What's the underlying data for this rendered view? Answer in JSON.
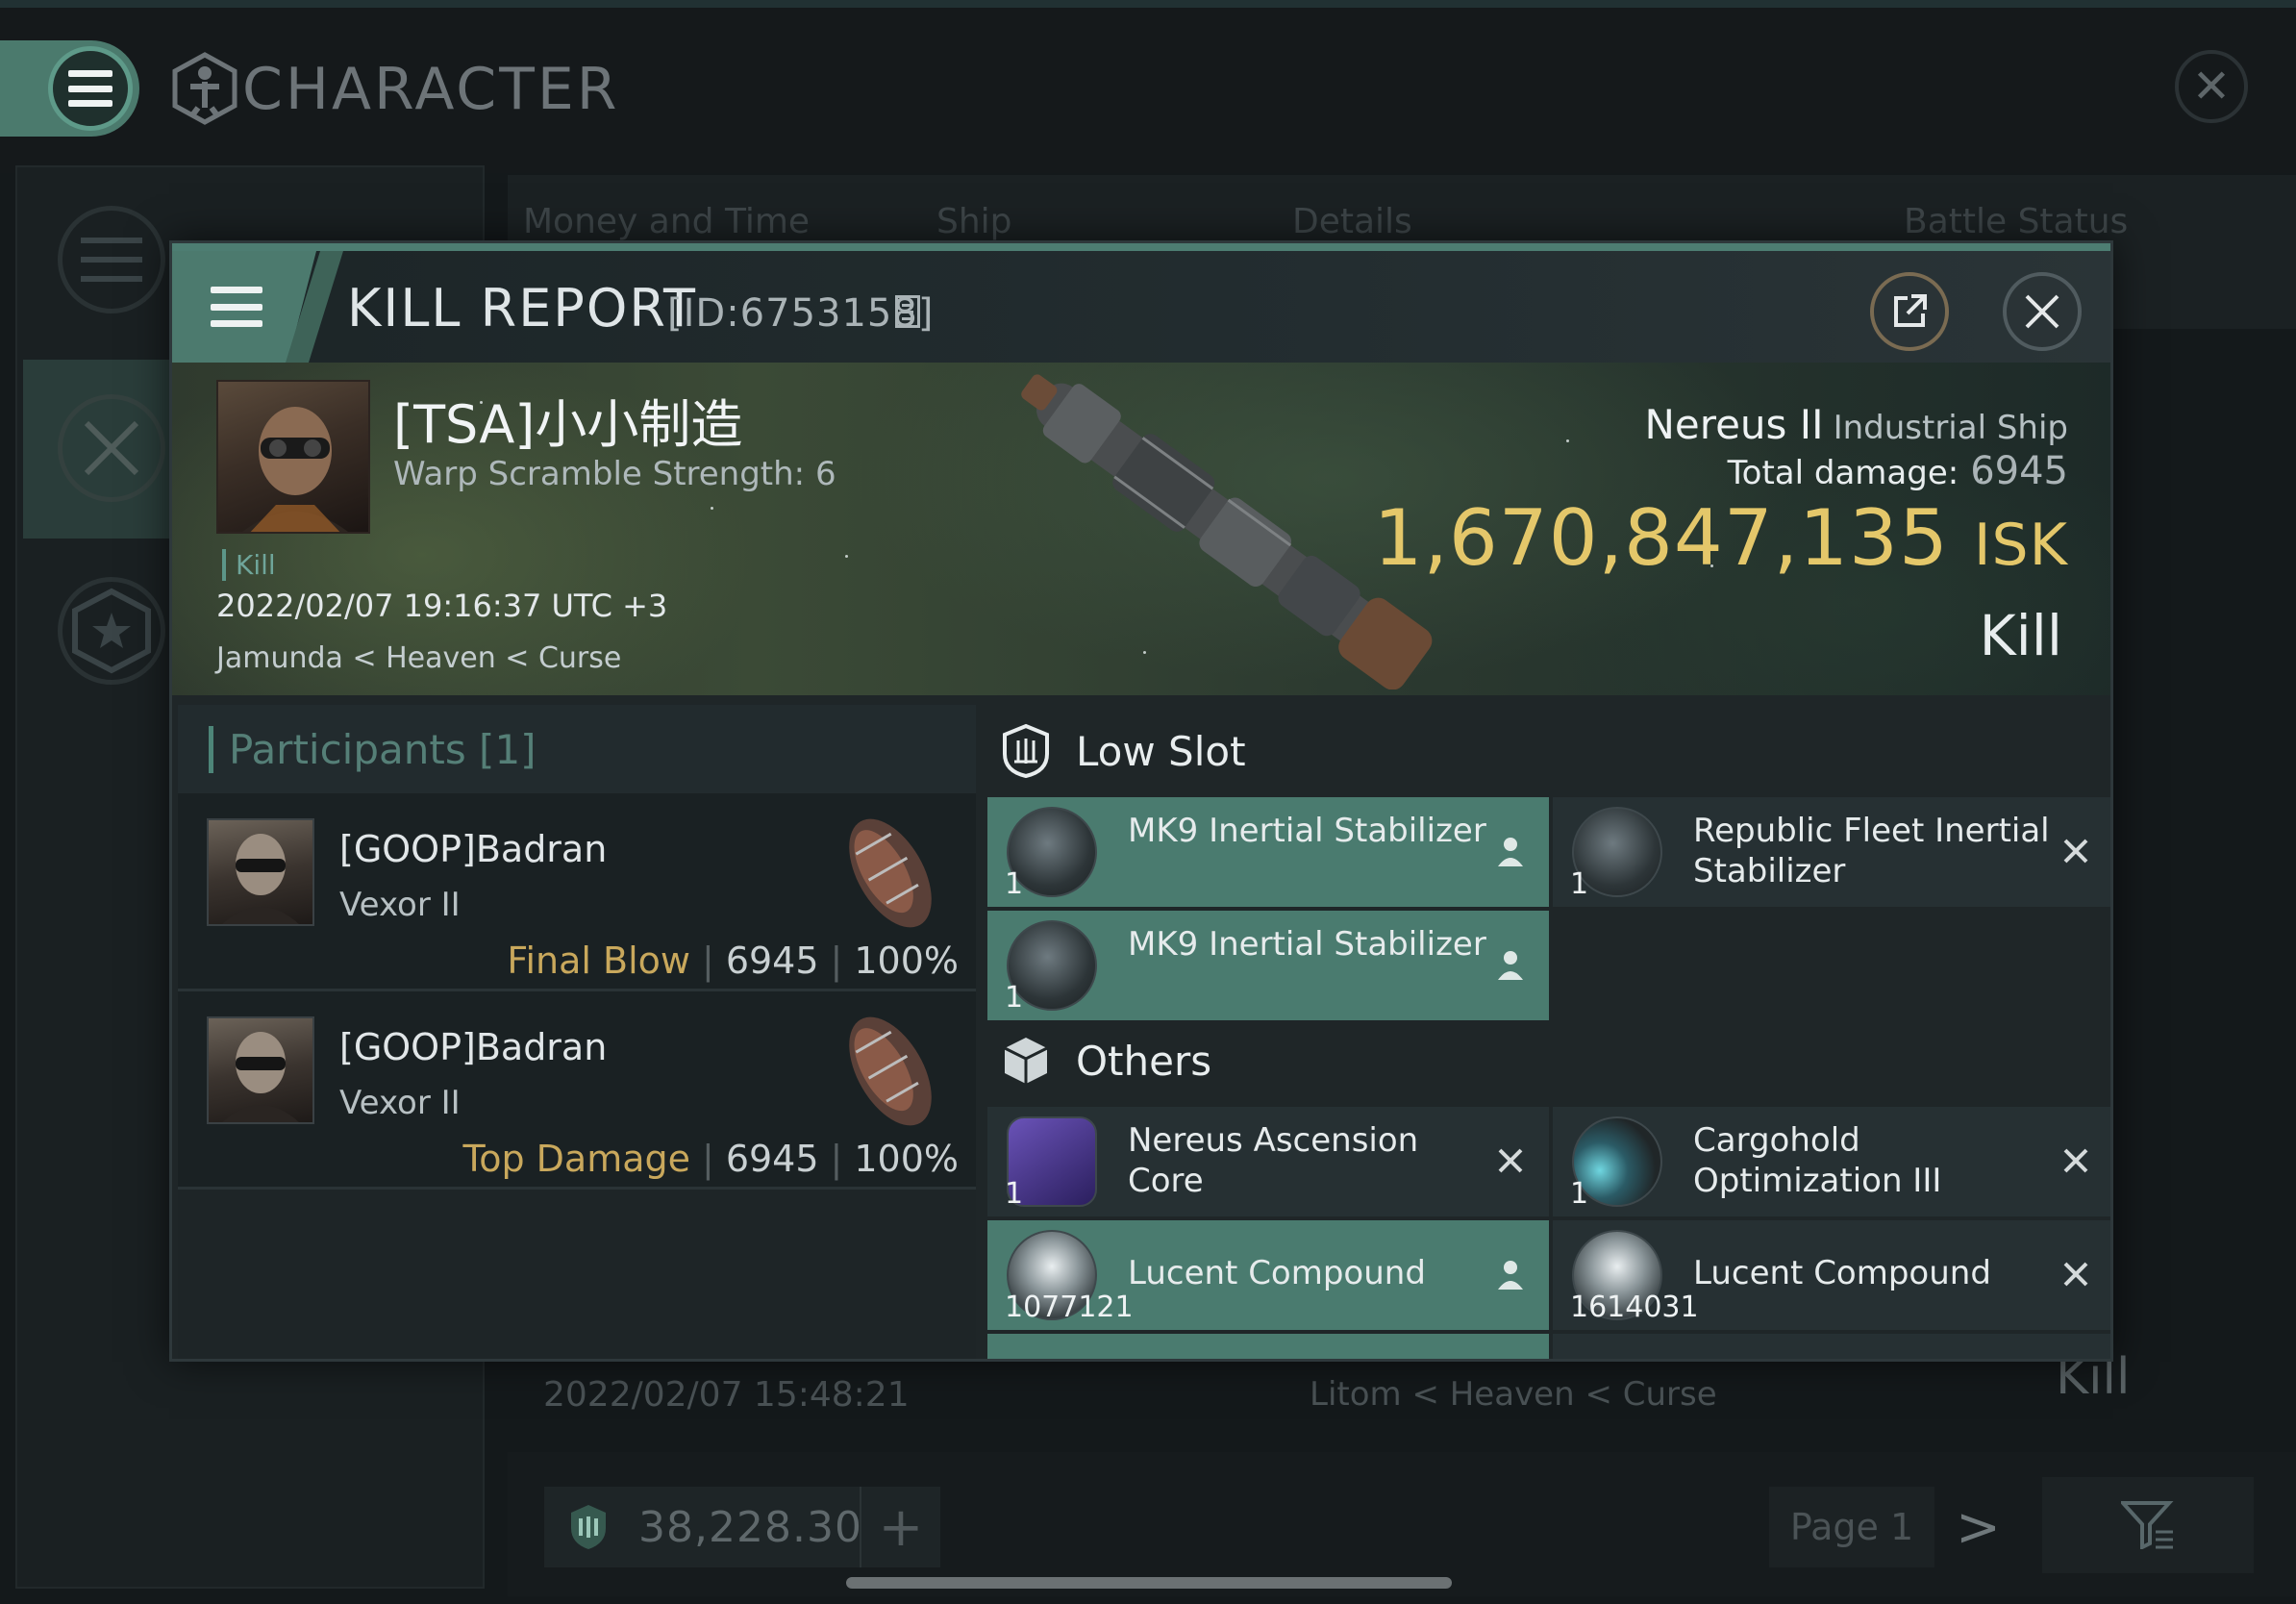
{
  "app": {
    "title": "CHARACTER"
  },
  "background": {
    "tabs": [
      "Money and Time",
      "Ship",
      "Details",
      "Battle Status"
    ],
    "list_item": {
      "date": "2022/02/07 15:48:21",
      "location": "Litom < Heaven < Curse",
      "result": "Kill"
    },
    "wallet": {
      "value": "38,228.30",
      "add_label": "+"
    },
    "pagination": {
      "page_label": "Page 1",
      "next": ">"
    }
  },
  "modal": {
    "title": "KILL REPORT",
    "id_text": "[ID:6753158]",
    "victim": {
      "name": "[TSA]小小制造",
      "warp": "Warp Scramble Strength: 6",
      "tag": "Kill",
      "time": "2022/02/07 19:16:37 UTC +3",
      "location": "Jamunda < Heaven < Curse"
    },
    "ship": {
      "name": "Nereus II",
      "class": "Industrial Ship",
      "damage_label": "Total damage:",
      "damage_value": "6945",
      "isk_value": "1,670,847,135",
      "isk_unit": "ISK",
      "result": "Kill"
    },
    "participants": {
      "title": "Participants [1]",
      "rows": [
        {
          "name": "[GOOP]Badran",
          "ship": "Vexor II",
          "label": "Final Blow",
          "damage": "6945",
          "percent": "100%"
        },
        {
          "name": "[GOOP]Badran",
          "ship": "Vexor II",
          "label": "Top Damage",
          "damage": "6945",
          "percent": "100%"
        }
      ]
    },
    "sections": {
      "low_slot": {
        "title": "Low Slot",
        "items": [
          {
            "name": "MK9 Inertial Stabilizer",
            "qty": "1",
            "status": "dropped"
          },
          {
            "name": "Republic Fleet Inertial Stabilizer",
            "qty": "1",
            "status": "destroyed"
          },
          {
            "name": "MK9 Inertial Stabilizer",
            "qty": "1",
            "status": "dropped"
          }
        ]
      },
      "others": {
        "title": "Others",
        "items": [
          {
            "name": "Nereus Ascension Core",
            "qty": "1",
            "status": "destroyed"
          },
          {
            "name": "Cargohold Optimization III",
            "qty": "1",
            "status": "destroyed"
          },
          {
            "name": "Lucent Compound",
            "qty": "1077121",
            "status": "dropped"
          },
          {
            "name": "Lucent Compound",
            "qty": "1614031",
            "status": "destroyed"
          }
        ]
      }
    }
  },
  "colors": {
    "accent": "#4a7b6f",
    "isk_gold": "#e4c76a",
    "label_gold": "#c9a85c"
  }
}
